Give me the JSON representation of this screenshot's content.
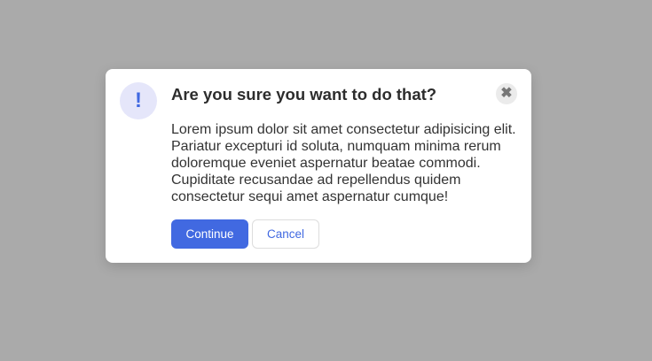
{
  "dialog": {
    "icon": "exclamation-icon",
    "icon_glyph": "!",
    "close_glyph": "✖",
    "title": "Are you sure you want to do that?",
    "message": "Lorem ipsum dolor sit amet consectetur adipisicing elit. Pariatur excepturi id soluta, numquam minima rerum doloremque eveniet aspernatur beatae commodi. Cupiditate recusandae ad repellendus quidem consectetur sequi amet aspernatur cumque!",
    "continue_label": "Continue",
    "cancel_label": "Cancel"
  },
  "colors": {
    "accent": "#4169e1",
    "overlay": "#aaaaaa"
  }
}
